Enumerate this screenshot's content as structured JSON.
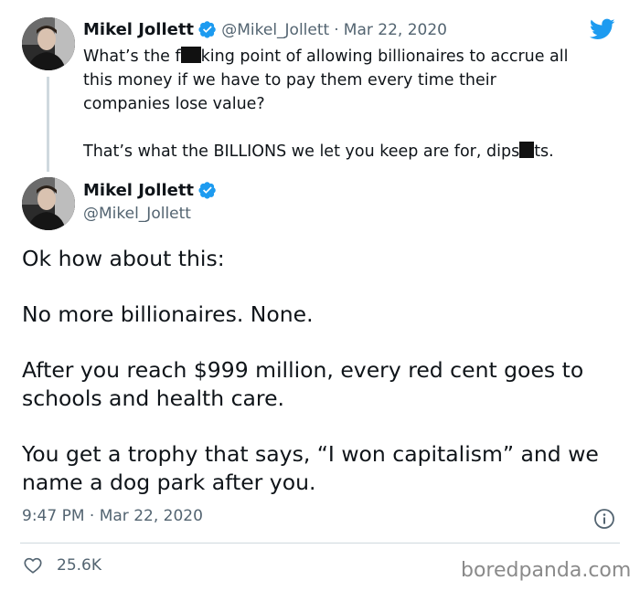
{
  "quoted_tweet": {
    "name": "Mikel Jollett",
    "handle": "@Mikel_Jollett",
    "sep": "·",
    "date": "Mar 22, 2020",
    "line1_a": "What’s the f",
    "line1_b": "king point of allowing billionaires to accrue all",
    "line2": "this money if we have to pay them every time their",
    "line3": "companies lose value?",
    "line4_a": "That’s what the BILLIONS we let you keep are for, dips",
    "line4_b": "ts."
  },
  "main_tweet": {
    "name": "Mikel Jollett",
    "handle": "@Mikel_Jollett",
    "paragraphs": [
      "Ok how about this:",
      "No more billionaires. None.",
      "After you reach $999 million, every red cent goes to schools and health care.",
      "You get a trophy that says, “I won capitalism” and we name a dog park after you."
    ],
    "time": "9:47 PM",
    "sep": "·",
    "date": "Mar 22, 2020",
    "likes": "25.6K"
  },
  "watermark": "boredpanda.com",
  "colors": {
    "twitter_blue": "#1d9bf0",
    "text": "#0f1419",
    "muted": "#536471"
  },
  "icons": [
    "twitter-bird-icon",
    "verified-badge-icon",
    "info-icon",
    "heart-icon"
  ]
}
